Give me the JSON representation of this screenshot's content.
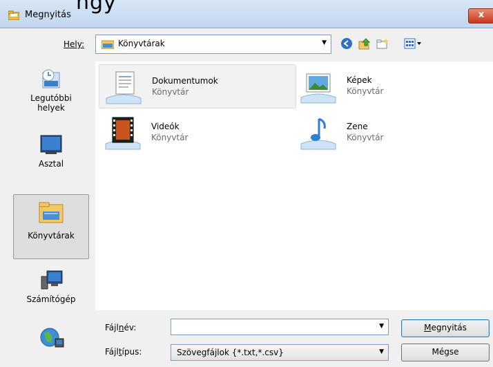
{
  "window": {
    "title": "Megnyitás",
    "ghost_text": "ngy",
    "close_label": "x"
  },
  "location": {
    "label": "Hely:",
    "value": "Könyvtárak"
  },
  "toolbar": {
    "icons": [
      "back-icon",
      "up-folder-icon",
      "new-folder-icon",
      "view-menu-icon"
    ]
  },
  "places": [
    {
      "label_line1": "Legutóbbi",
      "label_line2": "helyek",
      "icon": "recent-places-icon"
    },
    {
      "label_line1": "Asztal",
      "label_line2": "",
      "icon": "desktop-icon"
    },
    {
      "label_line1": "Könyvtárak",
      "label_line2": "",
      "icon": "libraries-icon",
      "selected": true
    },
    {
      "label_line1": "Számítógép",
      "label_line2": "",
      "icon": "computer-icon"
    },
    {
      "label_line1": "",
      "label_line2": "",
      "icon": "network-icon"
    }
  ],
  "items": [
    {
      "name": "Dokumentumok",
      "type": "Könyvtár",
      "icon": "documents-library-icon"
    },
    {
      "name": "Képek",
      "type": "Könyvtár",
      "icon": "pictures-library-icon"
    },
    {
      "name": "Videók",
      "type": "Könyvtár",
      "icon": "videos-library-icon"
    },
    {
      "name": "Zene",
      "type": "Könyvtár",
      "icon": "music-library-icon"
    }
  ],
  "filename": {
    "label_pre": "Fájl",
    "label_accel": "n",
    "label_post": "év:",
    "value": ""
  },
  "filetype": {
    "label_pre": "Fájl",
    "label_accel": "t",
    "label_post": "ípus:",
    "value": "Szövegfájlok {*.txt,*.csv}"
  },
  "buttons": {
    "open_accel": "M",
    "open_rest": "egnyitás",
    "cancel": "Mégse"
  },
  "colors": {
    "titlebar": "#c9dcf2",
    "close": "#c6381c",
    "selection": "#dedede"
  }
}
